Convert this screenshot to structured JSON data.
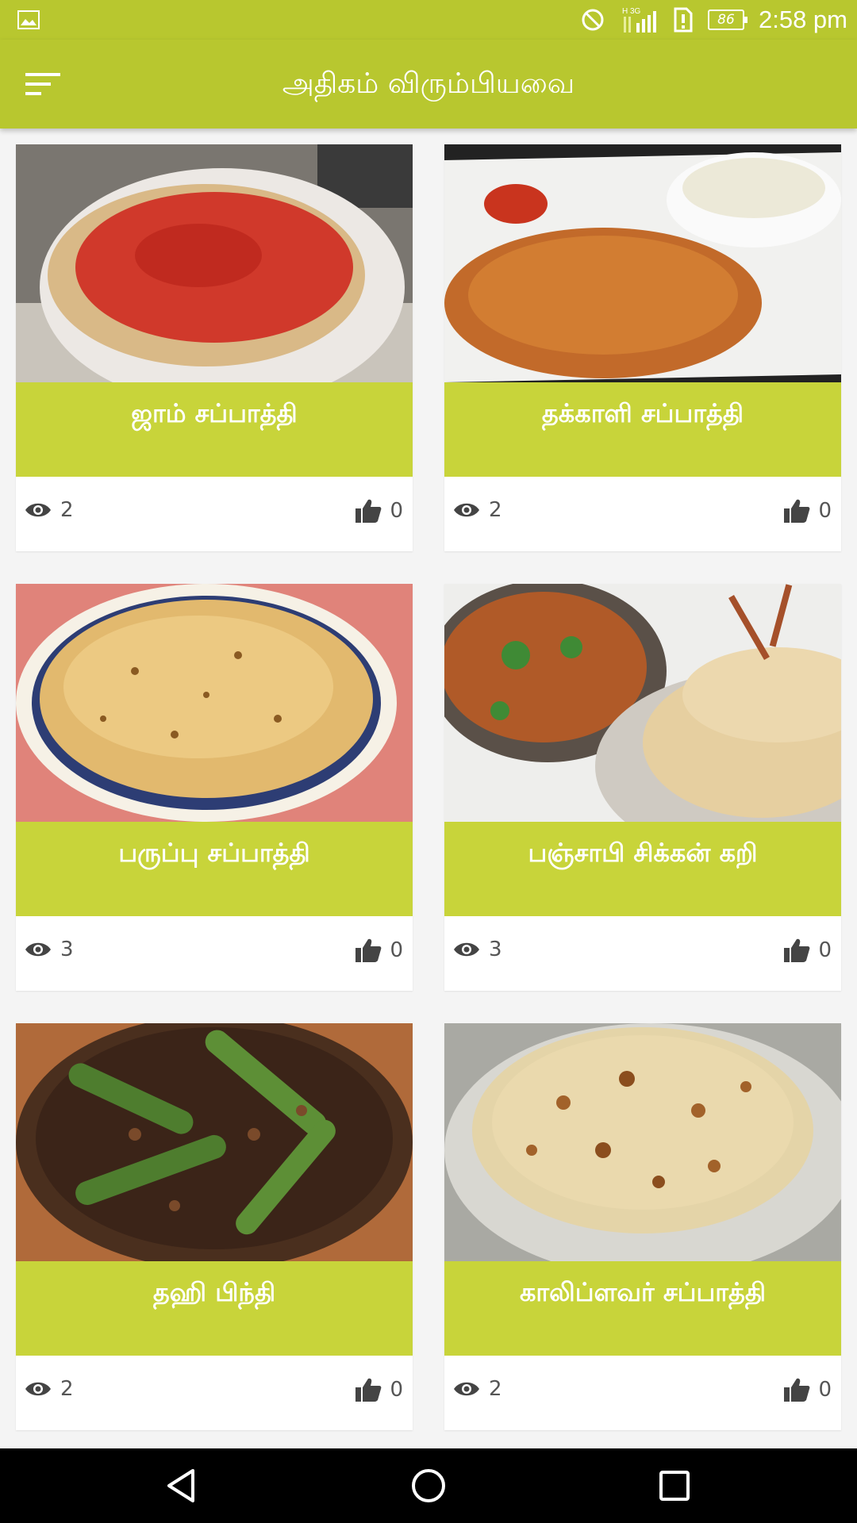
{
  "status_bar": {
    "time": "2:58 pm",
    "battery": "86",
    "network": "H 3G"
  },
  "app_bar": {
    "title": "அதிகம் விரும்பியவை"
  },
  "colors": {
    "accent": "#b8c72f",
    "card_band": "#c8d43a"
  },
  "recipes": [
    {
      "title": "ஜாம் சப்பாத்தி",
      "views": "2",
      "likes": "0"
    },
    {
      "title": "தக்காளி சப்பாத்தி",
      "views": "2",
      "likes": "0"
    },
    {
      "title": "பருப்பு சப்பாத்தி",
      "views": "3",
      "likes": "0"
    },
    {
      "title": "பஞ்சாபி சிக்கன் கறி",
      "views": "3",
      "likes": "0"
    },
    {
      "title": "தஹி பிந்தி",
      "views": "2",
      "likes": "0"
    },
    {
      "title": "காலிப்ளவர் சப்பாத்தி",
      "views": "2",
      "likes": "0"
    }
  ],
  "icons": {
    "menu": "menu-icon",
    "views": "eye-icon",
    "likes": "thumbs-up-icon",
    "back": "back-triangle-icon",
    "home": "home-circle-icon",
    "recents": "recents-square-icon"
  }
}
